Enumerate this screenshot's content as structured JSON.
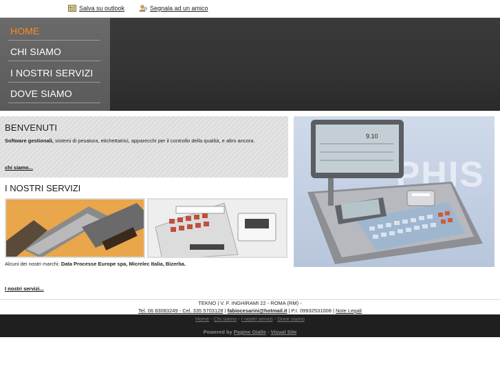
{
  "topbar": {
    "save_outlook": "Salva su outlook",
    "tell_friend": "Segnala ad un amico"
  },
  "nav": {
    "items": [
      {
        "label": "HOME",
        "active": true
      },
      {
        "label": "CHI SIAMO",
        "active": false
      },
      {
        "label": "I NOSTRI SERVIZI",
        "active": false
      },
      {
        "label": "DOVE SIAMO",
        "active": false
      }
    ],
    "active_color": "#ff8a1e"
  },
  "welcome": {
    "title": "BENVENUTI",
    "lead_bold": "Software gestionali,",
    "lead_rest": " sistemi di pesatura, etichettatrici, apparecchi per il controllo della qualità, e altro ancora.",
    "more_link": "chi siamo..."
  },
  "services": {
    "title": "I NOSTRI SERVIZI",
    "brands_prefix": "Alcuni dei nostri marchi: ",
    "brands_bold": "Data Processe Europe spa, Micrelec Italia, Bizerba.",
    "more_link": "I nostri servizi..."
  },
  "hero": {
    "watermark": "PHIS",
    "scale_display": "9.10"
  },
  "footer": {
    "address": "TEKNO | V. F. INGHIRAMI 22 - ROMA (RM) -",
    "contacts": "Tel. 06 83083249 - Cel. 335 5703128",
    "sep1": " | ",
    "email": "fabiocesarini@hotmail.it",
    "piva": " | P.I. 09932531008 | ",
    "legal": "Note Legali"
  },
  "bottom": {
    "links": [
      "Home",
      "Chi siamo",
      "I nostri servizi",
      "Dove siamo"
    ],
    "link_sep": " - ",
    "powered_prefix": "Powered by ",
    "powered_pg": "Pagine Gialle",
    "powered_sep": " - ",
    "powered_vs": "Visual Site"
  }
}
